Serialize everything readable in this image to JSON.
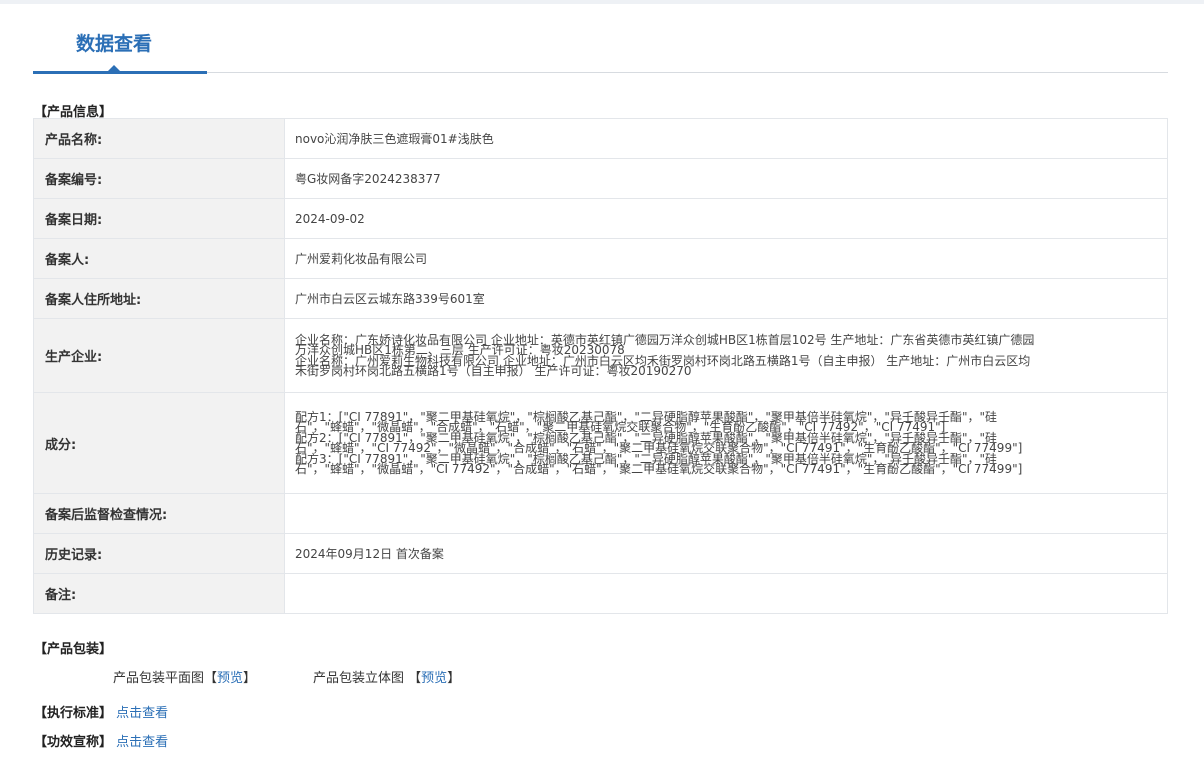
{
  "page": {
    "tab_title": "数据查看"
  },
  "product_info": {
    "section_title": "【产品信息】",
    "rows": [
      {
        "label": "产品名称:",
        "value": "novo沁润净肤三色遮瑕膏01#浅肤色"
      },
      {
        "label": "备案编号:",
        "value": "粤G妆网备字2024238377"
      },
      {
        "label": "备案日期:",
        "value": "2024-09-02"
      },
      {
        "label": "备案人:",
        "value": "广州爱莉化妆品有限公司"
      },
      {
        "label": "备案人住所地址:",
        "value": "广州市白云区云城东路339号601室"
      },
      {
        "label": "生产企业:",
        "lines": [
          "企业名称：广东娇诗化妆品有限公司 企业地址：英德市英红镇广德园万洋众创城HB区1栋首层102号 生产地址：广东省英德市英红镇广德园",
          "万洋众创城HB区1栋第二、三层 生产许可证：粤妆20230078",
          "企业名称：广州爱莉生物科技有限公司 企业地址：广州市白云区均禾街罗岗村环岗北路五横路1号（自主申报） 生产地址：广州市白云区均",
          "禾街罗岗村环岗北路五横路1号（自主申报） 生产许可证：粤妆20190270"
        ]
      },
      {
        "label": "成分:",
        "lines": [
          "配方1：[\"CI 77891\"，\"聚二甲基硅氧烷\"，\"棕榈酸乙基己酯\"，\"二异硬脂醇苹果酸酯\"，\"聚甲基倍半硅氧烷\"，\"异壬酸异壬酯\"，\"硅",
          "石\"，\"蜂蜡\"，\"微晶蜡\"，\"合成蜡\"，\"石蜡\"，\"聚二甲基硅氧烷交联聚合物\"，\"生育酚乙酸酯\"，\"CI 77492\"，\"CI 77491\"]",
          "配方2：[\"CI 77891\"，\"聚二甲基硅氧烷\"，\"棕榈酸乙基己酯\"，\"二异硬脂醇苹果酸酯\"，\"聚甲基倍半硅氧烷\"，\"异壬酸异壬酯\"，\"硅",
          "石\"，\"蜂蜡\"，\"CI 77492\"，\"微晶蜡\"，\"合成蜡\"，\"石蜡\"，\"聚二甲基硅氧烷交联聚合物\"，\"CI 77491\"，\"生育酚乙酸酯\"，\"CI 77499\"]",
          "配方3：[\"CI 77891\"，\"聚二甲基硅氧烷\"，\"棕榈酸乙基己酯\"，\"二异硬脂醇苹果酸酯\"，\"聚甲基倍半硅氧烷\"，\"异壬酸异壬酯\"，\"硅",
          "石\"，\"蜂蜡\"，\"微晶蜡\"，\"CI 77492\"，\"合成蜡\"，\"石蜡\"，\"聚二甲基硅氧烷交联聚合物\"，\"CI 77491\"，\"生育酚乙酸酯\"，\"CI 77499\"]"
        ]
      },
      {
        "label": "备案后监督检查情况:",
        "value": ""
      },
      {
        "label": "历史记录:",
        "value": "2024年09月12日 首次备案"
      },
      {
        "label": "备注:",
        "value": ""
      }
    ]
  },
  "packaging": {
    "section_title": "【产品包装】",
    "flat_label": "产品包装平面图",
    "stereo_label": "产品包装立体图",
    "bracket_open": "【",
    "bracket_close": "】",
    "preview_text": "预览"
  },
  "standard": {
    "label": "【执行标准】",
    "link": "点击查看"
  },
  "efficacy": {
    "label": "【功效宣称】",
    "link": "点击查看"
  }
}
